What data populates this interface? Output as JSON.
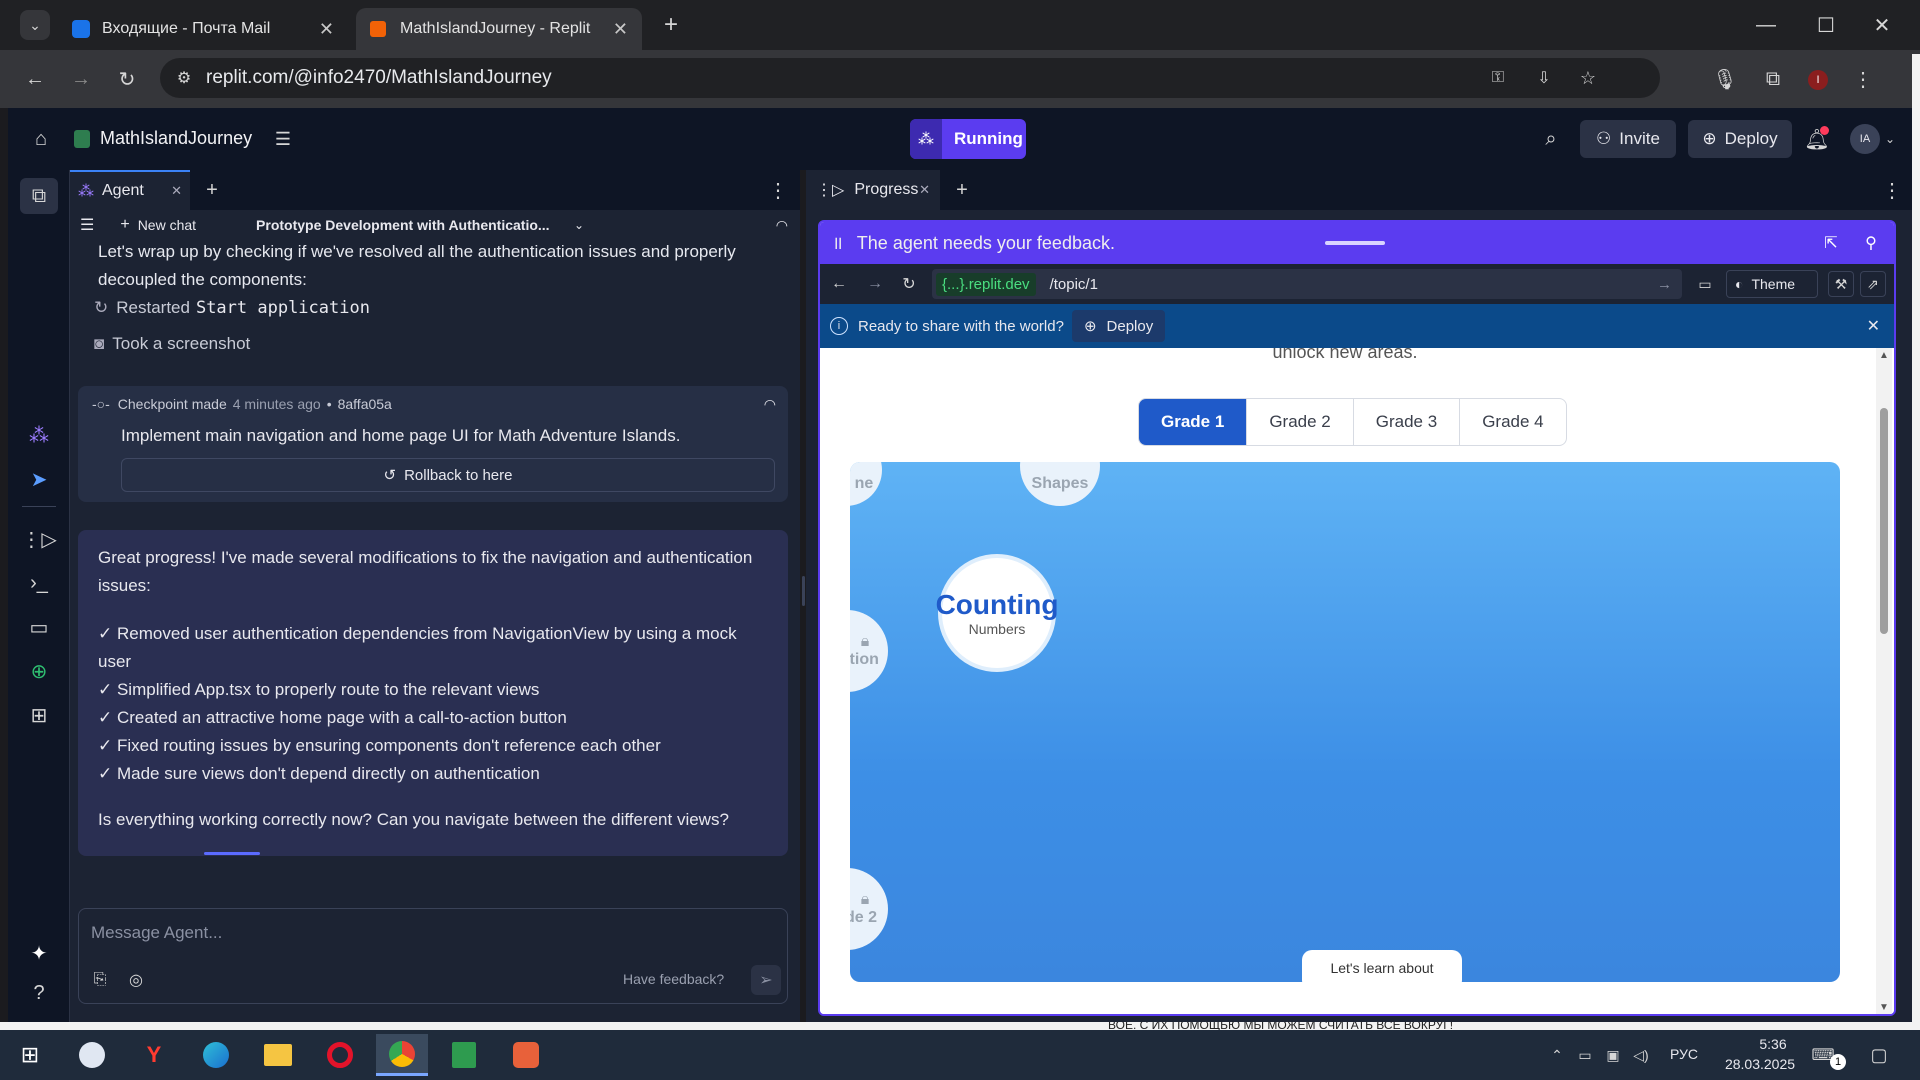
{
  "browser": {
    "tabs": [
      {
        "label": "Входящие - Почта Mail"
      },
      {
        "label": "MathIslandJourney - Replit"
      }
    ],
    "url": "replit.com/@info2470/MathIslandJourney"
  },
  "app": {
    "project_name": "MathIslandJourney",
    "run_label": "Running",
    "invite_label": "Invite",
    "deploy_label": "Deploy",
    "avatar": "IA"
  },
  "agent": {
    "tab_label": "Agent",
    "new_chat": "New chat",
    "chat_title": "Prototype Development with Authenticatio...",
    "intro_line": "Let's wrap up by checking if we've resolved all the authentication issues and properly decoupled the components:",
    "actions": [
      {
        "verb": "Restarted",
        "code": "Start application"
      },
      {
        "verb": "Took a screenshot",
        "code": ""
      }
    ],
    "checkpoint": {
      "label": "Checkpoint made",
      "time": "4 minutes ago",
      "bullet": "•",
      "hash": "8affa05a",
      "desc": "Implement main navigation and home page UI for Math Adventure Islands.",
      "rollback": "Rollback to here"
    },
    "message": {
      "intro": "Great progress! I've made several modifications to fix the navigation and authentication issues:",
      "items": [
        "✓ Removed user authentication dependencies from NavigationView by using a mock user",
        "✓ Simplified App.tsx to properly route to the relevant views",
        "✓ Created an attractive home page with a call-to-action button",
        "✓ Fixed routing issues by ensuring components don't reference each other",
        "✓ Made sure views don't depend directly on authentication"
      ],
      "question": "Is everything working correctly now? Can you navigate between the different views?"
    },
    "input_placeholder": "Message Agent...",
    "feedback": "Have feedback?"
  },
  "progress": {
    "tab_label": "Progress",
    "banner": "The agent needs your feedback.",
    "domain": "{...}.replit.dev",
    "path": "/topic/1",
    "theme_label": "Theme",
    "share_text": "Ready to share with the world?",
    "deploy_label": "Deploy",
    "page": {
      "top_text": "unlock new areas.",
      "grades": [
        "Grade 1",
        "Grade 2",
        "Grade 3",
        "Grade 4"
      ],
      "active_grade": "Grade 1",
      "nodes": {
        "shapes": "Shapes",
        "left1": "ne",
        "left2": "ition",
        "left3": "de 2",
        "counting": "Counting",
        "counting_sub": "Numbers"
      },
      "bottom_btn": "Let's learn about"
    }
  },
  "taskbar": {
    "lang": "РУС",
    "time": "5:36",
    "date": "28.03.2025",
    "notif": "1",
    "strip_text": "ВОЕ. С ИХ ПОМОЩЬЮ МЫ МОЖЕМ СЧИТАТЬ ВСЁ ВОКРУГ!"
  },
  "colors": {
    "accent": "#5b3cf0",
    "brand_orange": "#f26207",
    "preview_blue": "#3d8fe6"
  }
}
